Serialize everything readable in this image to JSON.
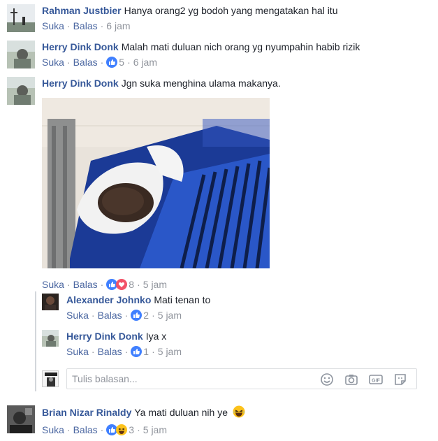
{
  "comments": [
    {
      "author": "Rahman Justbier",
      "text": "Hanya orang2 yg bodoh yang mengatakan hal itu",
      "like": "Suka",
      "reply": "Balas",
      "time": "6 jam"
    },
    {
      "author": "Herry Dink Donk",
      "text": "Malah mati duluan nich orang yg nyumpahin habib rizik",
      "like": "Suka",
      "reply": "Balas",
      "reactions": "5",
      "time": "6 jam"
    },
    {
      "author": "Herry Dink Donk",
      "text": "Jgn suka menghina ulama makanya.",
      "like": "Suka",
      "reply": "Balas",
      "reactions": "8",
      "time": "5 jam"
    },
    {
      "author": "Brian Nizar Rinaldy",
      "text": "Ya mati duluan nih ye",
      "like": "Suka",
      "reply": "Balas",
      "reactions": "3",
      "time": "5 jam"
    }
  ],
  "replies": [
    {
      "author": "Alexander Johnko",
      "text": "Mati tenan to",
      "like": "Suka",
      "reply": "Balas",
      "reactions": "2",
      "time": "5 jam"
    },
    {
      "author": "Herry Dink Donk",
      "text": "Iya x",
      "like": "Suka",
      "reply": "Balas",
      "reactions": "1",
      "time": "5 jam"
    }
  ],
  "reply_box": {
    "placeholder": "Tulis balasan..."
  },
  "colors": {
    "author": "#365899",
    "link": "#4b67a1",
    "meta": "#90949c",
    "like_blue": "#4080ff",
    "love_red": "#f25268"
  },
  "icons": [
    "like-icon",
    "love-icon",
    "haha-icon",
    "emoji-icon",
    "camera-icon",
    "gif-icon",
    "sticker-icon",
    "laughing-emoji"
  ]
}
